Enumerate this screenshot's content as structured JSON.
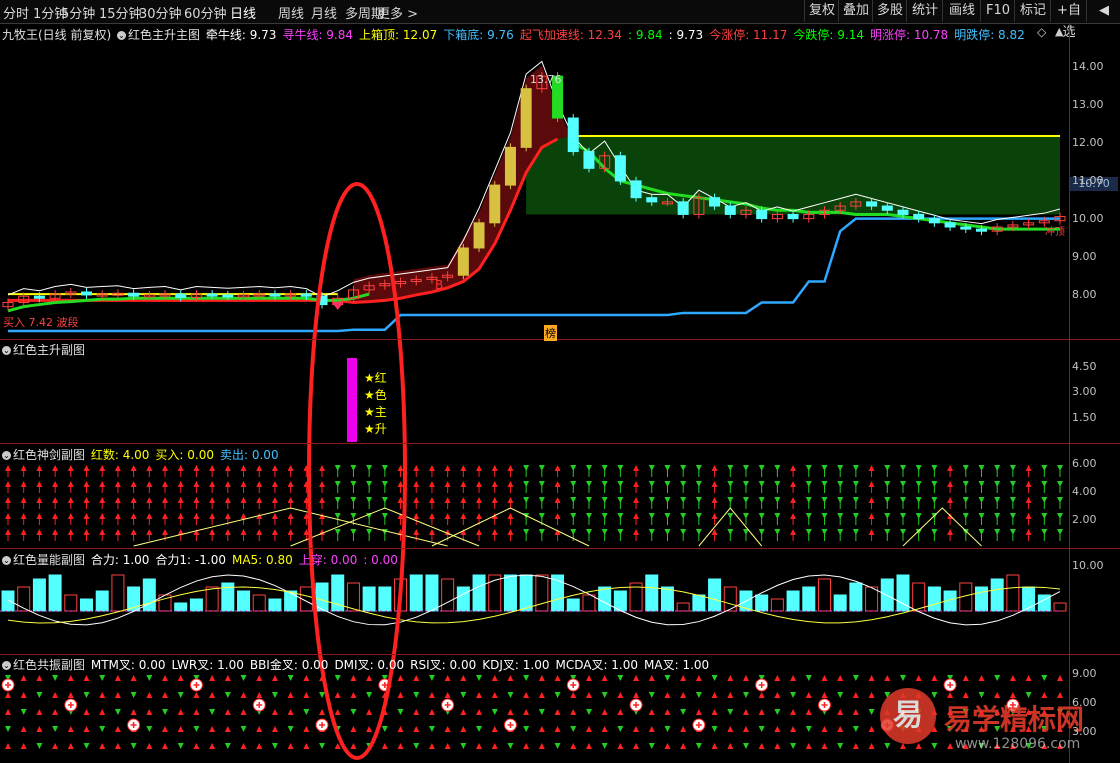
{
  "toolbar": {
    "periods": [
      "分时",
      "1分钟",
      "5分钟",
      "15分钟",
      "30分钟",
      "60分钟",
      "日线",
      "周线",
      "月线",
      "多周期",
      "更多 >"
    ],
    "active_period": "日线",
    "right_buttons": [
      "复权",
      "叠加",
      "多股",
      "统计",
      "画线",
      "F10",
      "标记",
      "+自选",
      "◀"
    ]
  },
  "main_header": {
    "stock": "九牧王(日线 前复权)",
    "indicator": "红色主升主图",
    "items": [
      {
        "label": "牵牛线: 9.73",
        "color": "#ffffff"
      },
      {
        "label": "寻牛线: 9.84",
        "color": "#ff40ff"
      },
      {
        "label": "上箱顶: 12.07",
        "color": "#ffff00"
      },
      {
        "label": "下箱底: 9.76",
        "color": "#40c0ff"
      },
      {
        "label": "起飞加速线: 12.34",
        "color": "#ff4040"
      },
      {
        "label": ": 9.84",
        "color": "#00ff00"
      },
      {
        "label": ": 9.73",
        "color": "#ffffff"
      },
      {
        "label": "今涨停: 11.17",
        "color": "#ff4040"
      },
      {
        "label": "今跌停: 9.14",
        "color": "#00ff00"
      },
      {
        "label": "明涨停: 10.78",
        "color": "#ff40ff"
      },
      {
        "label": "明跌停: 8.82",
        "color": "#40c0ff"
      }
    ],
    "header_icons": [
      "◇",
      "▲"
    ]
  },
  "main_chart": {
    "ticks": [
      "14.00",
      "13.00",
      "12.00",
      "11.00",
      "10.00",
      "9.00",
      "8.00"
    ],
    "current_price": "10.70",
    "peak_label": "13.76",
    "low_label": "7.42",
    "bottom_text": "买入 7.42 波段",
    "b_label": "B",
    "bang_label": "榜",
    "tail_label": "冲顶"
  },
  "sub1": {
    "title": "红色主升副图",
    "ticks": [
      "4.50",
      "3.00",
      "1.50"
    ],
    "stars": [
      "★红",
      "★色",
      "★主",
      "★升"
    ]
  },
  "sub2": {
    "title": "红色神剑副图",
    "items": [
      {
        "label": "红数: 4.00",
        "color": "#ffff00"
      },
      {
        "label": "买入: 0.00",
        "color": "#ffff00"
      },
      {
        "label": "卖出: 0.00",
        "color": "#40c0ff"
      }
    ],
    "ticks": [
      "6.00",
      "4.00",
      "2.00"
    ]
  },
  "sub3": {
    "title": "红色量能副图",
    "items": [
      {
        "label": "合力: 1.00",
        "color": "#ffffff"
      },
      {
        "label": "合力1: -1.00",
        "color": "#ffffff"
      },
      {
        "label": "MA5: 0.80",
        "color": "#ffff00"
      },
      {
        "label": "上穿: 0.00",
        "color": "#ff40ff"
      },
      {
        "label": ": 0.00",
        "color": "#ff40ff"
      }
    ],
    "ticks": [
      "10.00"
    ]
  },
  "sub4": {
    "title": "红色共振副图",
    "items": [
      {
        "label": "MTM叉: 0.00",
        "color": "#ffffff"
      },
      {
        "label": "LWR叉: 1.00",
        "color": "#ffffff"
      },
      {
        "label": "BBI金叉: 0.00",
        "color": "#ffffff"
      },
      {
        "label": "DMI叉: 0.00",
        "color": "#ffffff"
      },
      {
        "label": "RSI叉: 0.00",
        "color": "#ffffff"
      },
      {
        "label": "KDJ叉: 1.00",
        "color": "#ffffff"
      },
      {
        "label": "MCDA叉: 1.00",
        "color": "#ffffff"
      },
      {
        "label": "MA叉: 1.00",
        "color": "#ffffff"
      }
    ],
    "ticks": [
      "9.00",
      "6.00",
      "3.00"
    ]
  },
  "watermark": {
    "logo_char": "易",
    "site_name": "易学精标网",
    "url": "www.128096.com"
  },
  "chart_data": {
    "type": "candlestick",
    "closes": [
      8.1,
      8.25,
      8.2,
      8.3,
      8.35,
      8.28,
      8.3,
      8.32,
      8.25,
      8.28,
      8.3,
      8.22,
      8.3,
      8.28,
      8.26,
      8.28,
      8.3,
      8.27,
      8.3,
      8.25,
      8.05,
      8.2,
      8.4,
      8.5,
      8.55,
      8.6,
      8.65,
      8.7,
      8.75,
      9.4,
      10.0,
      10.9,
      11.8,
      13.2,
      13.5,
      12.5,
      11.7,
      11.3,
      11.6,
      11.0,
      10.6,
      10.5,
      10.5,
      10.2,
      10.6,
      10.4,
      10.2,
      10.3,
      10.1,
      10.2,
      10.1,
      10.2,
      10.3,
      10.4,
      10.5,
      10.4,
      10.3,
      10.2,
      10.1,
      10.0,
      9.9,
      9.85,
      9.8,
      9.9,
      9.95,
      10.0,
      10.05,
      10.15
    ],
    "ylim": [
      7.3,
      14.6
    ]
  }
}
